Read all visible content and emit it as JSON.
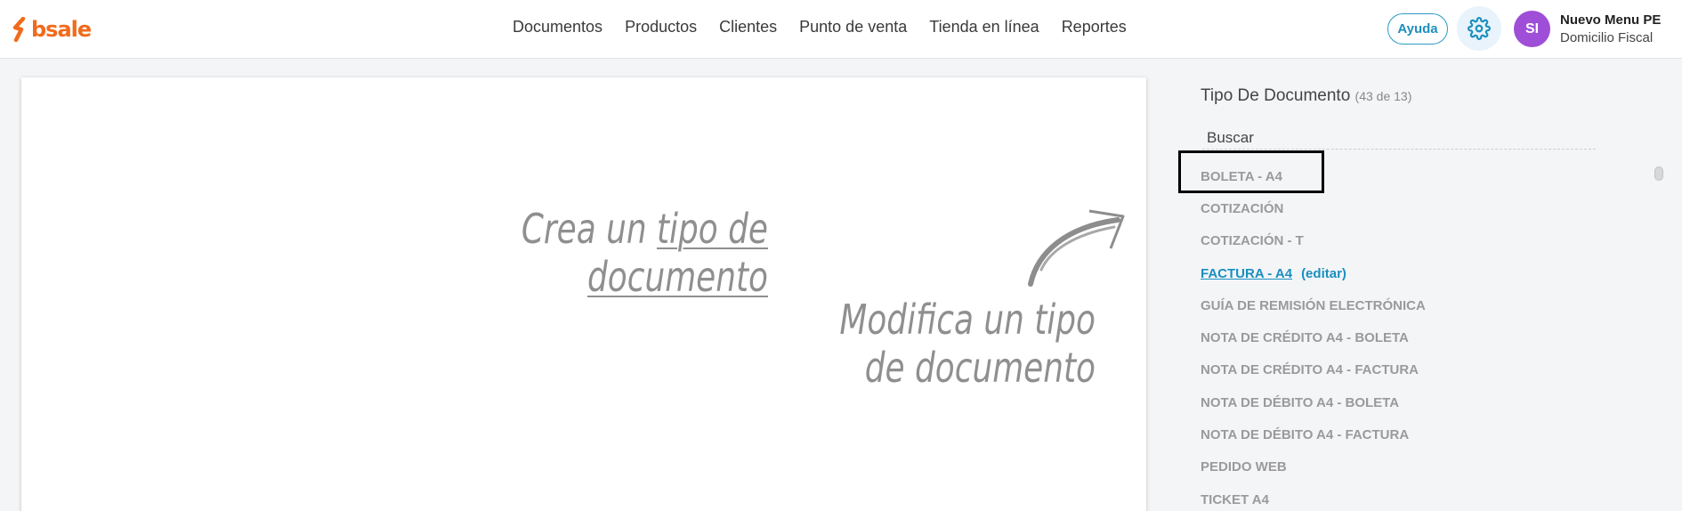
{
  "brand": {
    "logo_text": "bsale",
    "accent": "#f26a1b"
  },
  "nav": [
    "Documentos",
    "Productos",
    "Clientes",
    "Punto de venta",
    "Tienda en línea",
    "Reportes"
  ],
  "header": {
    "help_label": "Ayuda",
    "settings_icon": "gear-icon",
    "avatar_initials": "SI",
    "user_name": "Nuevo Menu PE",
    "user_subtitle": "Domicilio Fiscal"
  },
  "canvas": {
    "create_prefix": "Crea un ",
    "create_link": "tipo de",
    "create_link2": "documento",
    "modify_line1": "Modifica un tipo",
    "modify_line2": "de documento"
  },
  "panel": {
    "title": "Tipo De Documento",
    "count": "(43 de 13)",
    "search_placeholder": "Buscar",
    "edit_label": "(editar)",
    "items": [
      {
        "label": "BOLETA - A4",
        "active": false
      },
      {
        "label": "COTIZACIÓN",
        "active": false
      },
      {
        "label": "COTIZACIÓN - T",
        "active": false
      },
      {
        "label": "FACTURA - A4 ",
        "active": true
      },
      {
        "label": "GUÍA DE REMISIÓN ELECTRÓNICA",
        "active": false
      },
      {
        "label": "NOTA DE CRÉDITO A4 - BOLETA",
        "active": false
      },
      {
        "label": "NOTA DE CRÉDITO A4 - FACTURA",
        "active": false
      },
      {
        "label": "NOTA DE DÉBITO A4 - BOLETA",
        "active": false
      },
      {
        "label": "NOTA DE DÉBITO A4 - FACTURA",
        "active": false
      },
      {
        "label": "PEDIDO WEB",
        "active": false
      },
      {
        "label": "TICKET A4",
        "active": false
      }
    ]
  }
}
